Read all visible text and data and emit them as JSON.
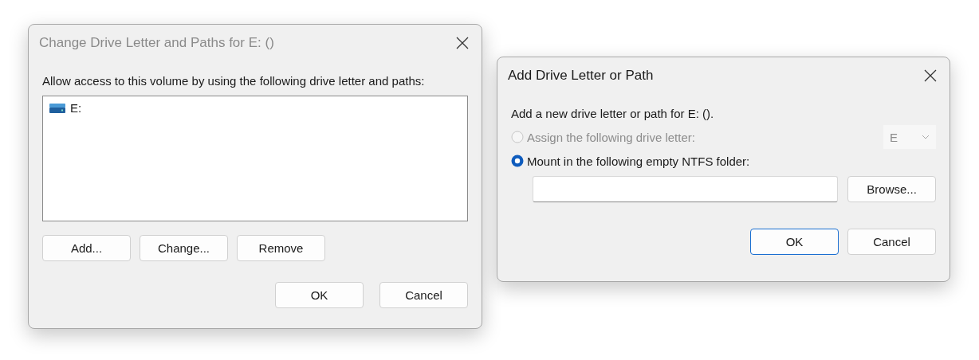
{
  "change_dialog": {
    "title": "Change Drive Letter and Paths for E: ()",
    "active": false,
    "instruction": "Allow access to this volume by using the following drive letter and paths:",
    "paths": [
      {
        "label": "E:"
      }
    ],
    "action_buttons": [
      {
        "label": "Add..."
      },
      {
        "label": "Change..."
      },
      {
        "label": "Remove"
      }
    ],
    "buttons": [
      {
        "label": "OK",
        "default": false
      },
      {
        "label": "Cancel",
        "default": false
      }
    ]
  },
  "add_dialog": {
    "title": "Add Drive Letter or Path",
    "active": true,
    "instruction": "Add a new drive letter or path for E: ().",
    "options": [
      {
        "label": "Assign the following drive letter:",
        "selected": false,
        "disabled": true,
        "kind": "letter",
        "value": "E"
      },
      {
        "label": "Mount in the following empty NTFS folder:",
        "selected": true,
        "disabled": false,
        "kind": "folder",
        "browse": "Browse..."
      }
    ],
    "buttons": [
      {
        "label": "OK",
        "default": true
      },
      {
        "label": "Cancel",
        "default": false
      }
    ]
  }
}
